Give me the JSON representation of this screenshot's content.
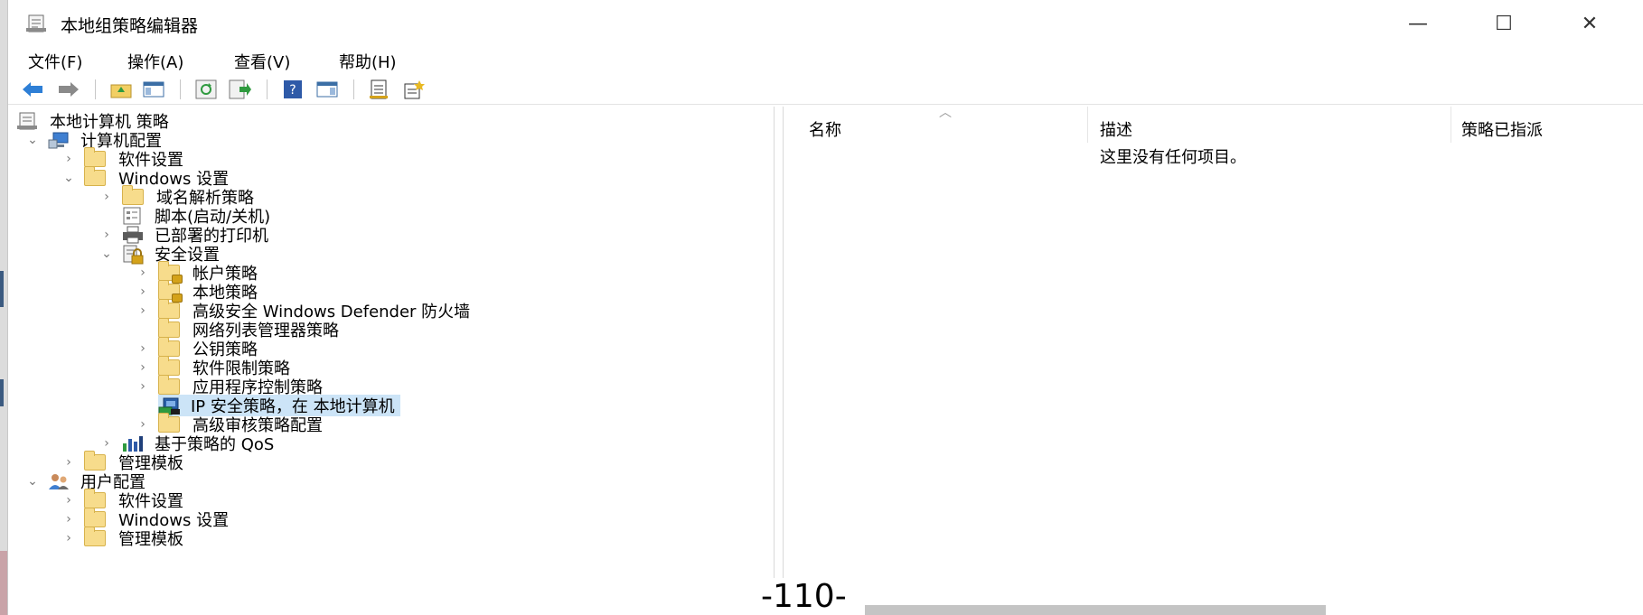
{
  "window": {
    "title": "本地组策略编辑器",
    "buttons": {
      "minimize": "—",
      "maximize": "☐",
      "close": "✕"
    }
  },
  "menu": {
    "items": [
      "文件(F)",
      "操作(A)",
      "查看(V)",
      "帮助(H)"
    ]
  },
  "toolbar": {
    "icons": [
      "back-arrow-icon",
      "forward-arrow-icon",
      "up-folder-icon",
      "show-hide-tree-icon",
      "refresh-icon",
      "export-list-icon",
      "help-icon",
      "show-action-pane-icon",
      "properties-icon",
      "new-policy-icon"
    ]
  },
  "tree": {
    "items": [
      {
        "label": "本地计算机 策略",
        "icon": "policy-document-icon"
      },
      {
        "label": "计算机配置",
        "icon": "computer-icon",
        "expanded": true
      },
      {
        "label": "软件设置",
        "icon": "folder-icon"
      },
      {
        "label": "Windows 设置",
        "icon": "folder-icon",
        "expanded": true
      },
      {
        "label": "域名解析策略",
        "icon": "folder-icon"
      },
      {
        "label": "脚本(启动/关机)",
        "icon": "script-icon"
      },
      {
        "label": "已部署的打印机",
        "icon": "printer-icon"
      },
      {
        "label": "安全设置",
        "icon": "security-settings-icon",
        "expanded": true
      },
      {
        "label": "帐户策略",
        "icon": "locked-folder-icon"
      },
      {
        "label": "本地策略",
        "icon": "locked-folder-icon"
      },
      {
        "label": "高级安全 Windows Defender 防火墙",
        "icon": "folder-icon"
      },
      {
        "label": "网络列表管理器策略",
        "icon": "folder-icon"
      },
      {
        "label": "公钥策略",
        "icon": "folder-icon"
      },
      {
        "label": "软件限制策略",
        "icon": "folder-icon"
      },
      {
        "label": "应用程序控制策略",
        "icon": "folder-icon"
      },
      {
        "label": "IP 安全策略，在 本地计算机",
        "icon": "ip-security-icon",
        "selected": true
      },
      {
        "label": "高级审核策略配置",
        "icon": "folder-icon"
      },
      {
        "label": "基于策略的 QoS",
        "icon": "qos-chart-icon"
      },
      {
        "label": "管理模板",
        "icon": "folder-icon"
      },
      {
        "label": "用户配置",
        "icon": "user-icon",
        "expanded": true
      },
      {
        "label": "软件设置",
        "icon": "folder-icon"
      },
      {
        "label": "Windows 设置",
        "icon": "folder-icon"
      },
      {
        "label": "管理模板",
        "icon": "folder-icon"
      }
    ]
  },
  "list": {
    "columns": [
      "名称",
      "描述",
      "策略已指派"
    ],
    "empty_message": "这里没有任何项目。"
  },
  "page_number": "-110-"
}
